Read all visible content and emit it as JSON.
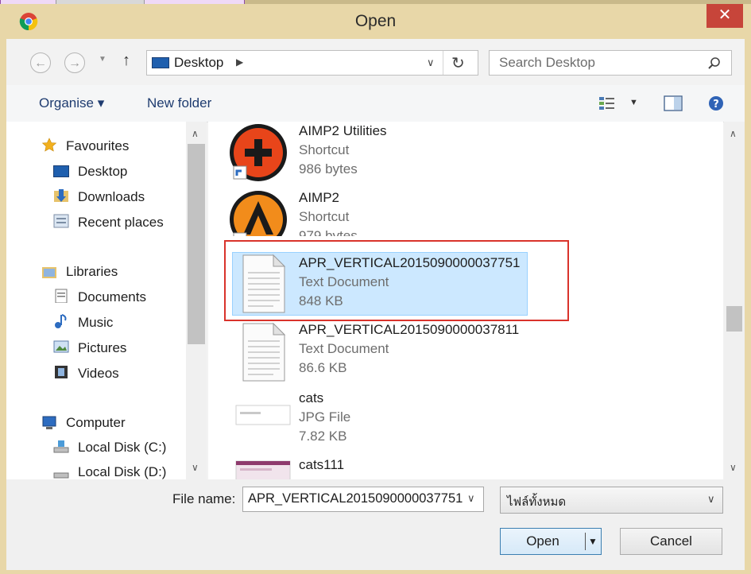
{
  "window": {
    "title": "Open",
    "close_glyph": "✕"
  },
  "address": {
    "location": "Desktop",
    "search_placeholder": "Search Desktop"
  },
  "toolbar": {
    "organise_label": "Organise ▾",
    "new_folder_label": "New folder"
  },
  "nav": {
    "favourites": "Favourites",
    "desktop": "Desktop",
    "downloads": "Downloads",
    "recent": "Recent places",
    "libraries": "Libraries",
    "documents": "Documents",
    "music": "Music",
    "pictures": "Pictures",
    "videos": "Videos",
    "computer": "Computer",
    "disk_c": "Local Disk (C:)",
    "disk_d": "Local Disk (D:)"
  },
  "files": [
    {
      "name": "AIMP2 Utilities",
      "type": "Shortcut",
      "size": "986 bytes",
      "icon": "aimp-utilities-icon"
    },
    {
      "name": "AIMP2",
      "type": "Shortcut",
      "size": "979 bytes",
      "icon": "aimp-icon"
    },
    {
      "name": "APR_VERTICAL2015090000037751",
      "type": "Text Document",
      "size": "848 KB",
      "icon": "text-document-icon",
      "selected": true
    },
    {
      "name": "APR_VERTICAL2015090000037811",
      "type": "Text Document",
      "size": "86.6 KB",
      "icon": "text-document-icon"
    },
    {
      "name": "cats",
      "type": "JPG File",
      "size": "7.82 KB",
      "icon": "jpg-thumbnail-icon"
    },
    {
      "name": "cats111",
      "type": "",
      "size": "",
      "icon": "jpg-thumbnail-icon"
    }
  ],
  "bottom": {
    "file_name_label": "File name:",
    "file_name_value": "APR_VERTICAL2015090000037751",
    "file_type_value": "ไฟล์ทั้งหมด",
    "open_label": "Open",
    "cancel_label": "Cancel"
  },
  "colors": {
    "selection_fill": "#cce8ff",
    "selection_border": "#99d1ff",
    "highlight_box": "#d9332b"
  }
}
